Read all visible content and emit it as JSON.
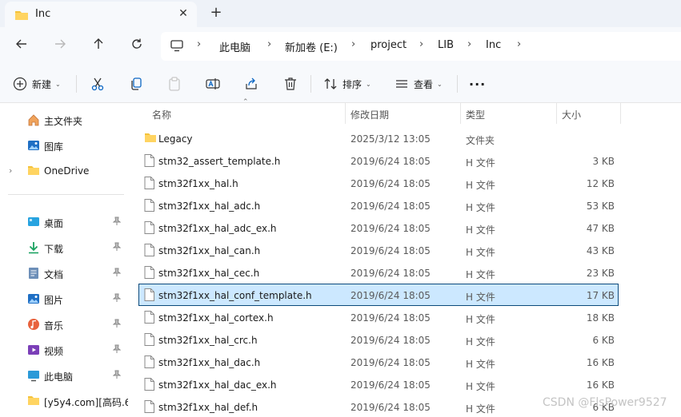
{
  "tab": {
    "title": "Inc",
    "close": "✕",
    "new_tab": "+"
  },
  "address": {
    "crumbs": [
      "此电脑",
      "新加卷 (E:)",
      "project",
      "LIB",
      "Inc"
    ],
    "separator": "›"
  },
  "commands": {
    "new_label": "新建",
    "sort_label": "排序",
    "view_label": "查看",
    "more": "···"
  },
  "sidebar": {
    "quick": [
      {
        "label": "主文件夹",
        "icon": "home-icon"
      },
      {
        "label": "图库",
        "icon": "gallery-icon"
      },
      {
        "label": "OneDrive",
        "icon": "folder-icon"
      }
    ],
    "pinned": [
      {
        "label": "桌面",
        "icon": "desktop-icon"
      },
      {
        "label": "下载",
        "icon": "download-icon"
      },
      {
        "label": "文档",
        "icon": "documents-icon"
      },
      {
        "label": "图片",
        "icon": "pictures-icon"
      },
      {
        "label": "音乐",
        "icon": "music-icon"
      },
      {
        "label": "视频",
        "icon": "video-icon"
      },
      {
        "label": "此电脑",
        "icon": "computer-icon"
      }
    ],
    "extra": {
      "label": "[y5y4.com][高码.6",
      "icon": "folder-icon"
    },
    "pin_glyph": "📌"
  },
  "columns": {
    "name": "名称",
    "modified": "修改日期",
    "type": "类型",
    "size": "大小"
  },
  "files": [
    {
      "name": "Legacy",
      "modified": "2025/3/12 13:05",
      "type": "文件夹",
      "size": "",
      "kind": "folder"
    },
    {
      "name": "stm32_assert_template.h",
      "modified": "2019/6/24 18:05",
      "type": "H 文件",
      "size": "3 KB",
      "kind": "file"
    },
    {
      "name": "stm32f1xx_hal.h",
      "modified": "2019/6/24 18:05",
      "type": "H 文件",
      "size": "12 KB",
      "kind": "file"
    },
    {
      "name": "stm32f1xx_hal_adc.h",
      "modified": "2019/6/24 18:05",
      "type": "H 文件",
      "size": "53 KB",
      "kind": "file"
    },
    {
      "name": "stm32f1xx_hal_adc_ex.h",
      "modified": "2019/6/24 18:05",
      "type": "H 文件",
      "size": "47 KB",
      "kind": "file"
    },
    {
      "name": "stm32f1xx_hal_can.h",
      "modified": "2019/6/24 18:05",
      "type": "H 文件",
      "size": "43 KB",
      "kind": "file"
    },
    {
      "name": "stm32f1xx_hal_cec.h",
      "modified": "2019/6/24 18:05",
      "type": "H 文件",
      "size": "23 KB",
      "kind": "file"
    },
    {
      "name": "stm32f1xx_hal_conf_template.h",
      "modified": "2019/6/24 18:05",
      "type": "H 文件",
      "size": "17 KB",
      "kind": "file",
      "selected": true
    },
    {
      "name": "stm32f1xx_hal_cortex.h",
      "modified": "2019/6/24 18:05",
      "type": "H 文件",
      "size": "18 KB",
      "kind": "file"
    },
    {
      "name": "stm32f1xx_hal_crc.h",
      "modified": "2019/6/24 18:05",
      "type": "H 文件",
      "size": "6 KB",
      "kind": "file"
    },
    {
      "name": "stm32f1xx_hal_dac.h",
      "modified": "2019/6/24 18:05",
      "type": "H 文件",
      "size": "16 KB",
      "kind": "file"
    },
    {
      "name": "stm32f1xx_hal_dac_ex.h",
      "modified": "2019/6/24 18:05",
      "type": "H 文件",
      "size": "16 KB",
      "kind": "file"
    },
    {
      "name": "stm32f1xx_hal_def.h",
      "modified": "2019/6/24 18:05",
      "type": "H 文件",
      "size": "6 KB",
      "kind": "file"
    }
  ],
  "watermark": "CSDN @FlsPower9527",
  "colors": {
    "selection": "#cce8ff",
    "selection_border": "#0b4a7c",
    "folder": "#f4c23a",
    "accent": "#0b66c3"
  }
}
